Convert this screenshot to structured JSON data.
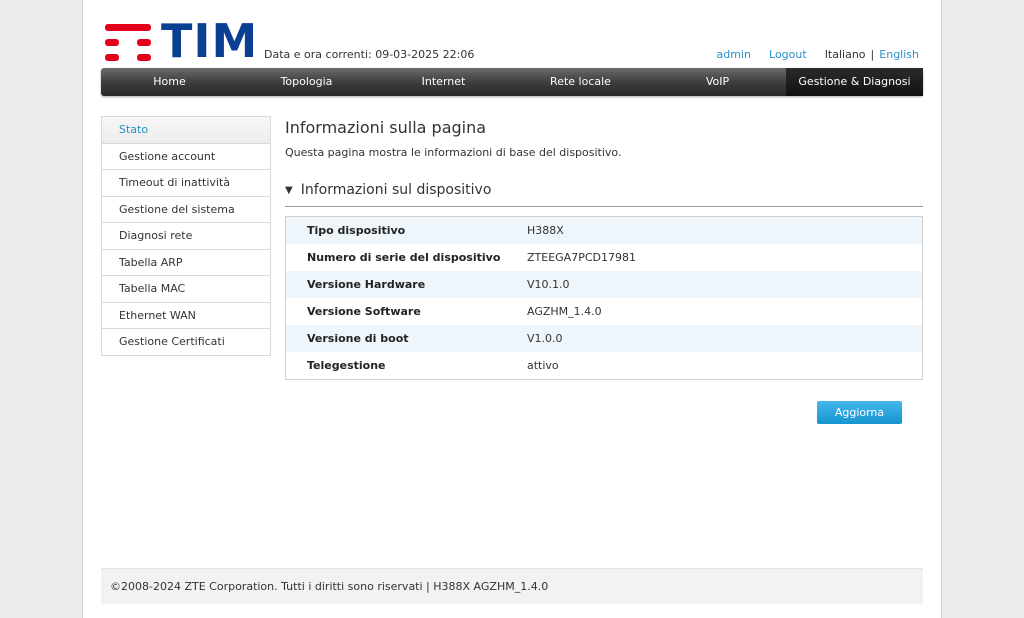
{
  "header": {
    "brand": "TIM",
    "datetime_label": "Data e ora correnti: 09-03-2025 22:06",
    "user": "admin",
    "logout": "Logout",
    "lang_current": "Italiano",
    "lang_separator": "|",
    "lang_other": "English"
  },
  "nav": {
    "items": [
      "Home",
      "Topologia",
      "Internet",
      "Rete locale",
      "VoIP",
      "Gestione & Diagnosi"
    ],
    "active": "Gestione & Diagnosi"
  },
  "sidebar": {
    "items": [
      "Stato",
      "Gestione account",
      "Timeout di inattività",
      "Gestione del sistema",
      "Diagnosi rete",
      "Tabella ARP",
      "Tabella MAC",
      "Ethernet WAN",
      "Gestione Certificati"
    ],
    "active": "Stato"
  },
  "main": {
    "title": "Informazioni sulla pagina",
    "description": "Questa pagina mostra le informazioni di base del dispositivo.",
    "section_title": "Informazioni sul dispositivo",
    "rows": [
      {
        "label": "Tipo dispositivo",
        "value": "H388X"
      },
      {
        "label": "Numero di serie del dispositivo",
        "value": "ZTEEGA7PCD17981"
      },
      {
        "label": "Versione Hardware",
        "value": "V10.1.0"
      },
      {
        "label": "Versione Software",
        "value": "AGZHM_1.4.0"
      },
      {
        "label": "Versione di boot",
        "value": "V1.0.0"
      },
      {
        "label": "Telegestione",
        "value": "attivo"
      }
    ],
    "refresh_label": "Aggiorna"
  },
  "footer": {
    "text": "©2008-2024 ZTE Corporation. Tutti i diritti sono riservati  |   H388X AGZHM_1.4.0"
  },
  "colors": {
    "brand_red": "#e2001a",
    "brand_blue": "#0b3f91",
    "link_blue": "#2a92c8",
    "button_blue": "#1594cf",
    "row_tint": "#eef6fc"
  }
}
